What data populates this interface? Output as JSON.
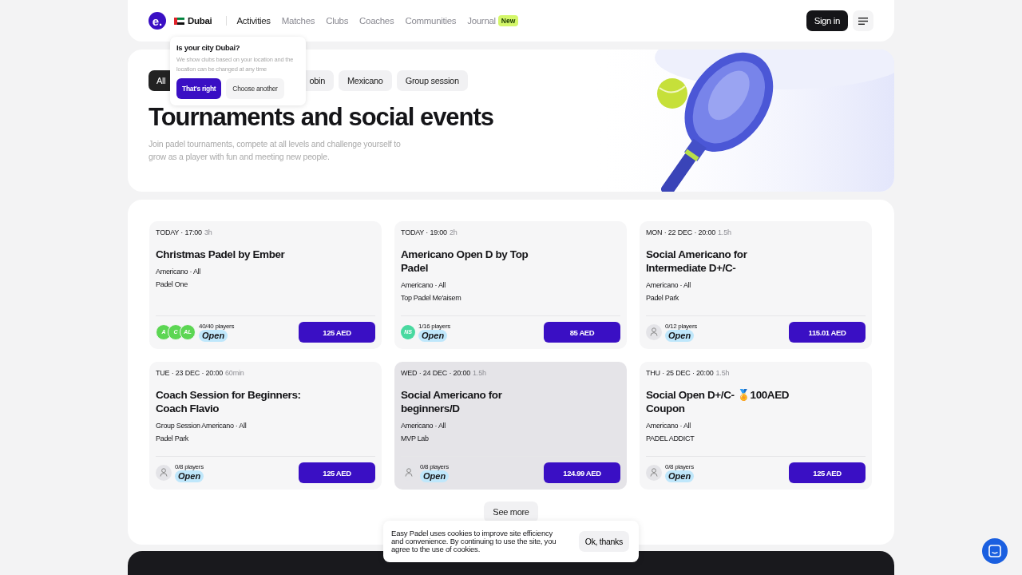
{
  "header": {
    "logo": "e.",
    "city": "Dubai",
    "nav": [
      {
        "label": "Activities",
        "selected": true
      },
      {
        "label": "Matches",
        "selected": false
      },
      {
        "label": "Clubs",
        "selected": false
      },
      {
        "label": "Coaches",
        "selected": false
      },
      {
        "label": "Communities",
        "selected": false
      },
      {
        "label": "Journal",
        "selected": false,
        "badge": "New"
      }
    ],
    "sign_in": "Sign in"
  },
  "city_popover": {
    "title": "Is your city Dubai?",
    "text": "We show clubs based on your location and the location can be changed at any time",
    "confirm": "That's right",
    "other": "Choose another"
  },
  "hero": {
    "filters": [
      {
        "label": "All",
        "selected": true
      },
      {
        "label": "obin",
        "selected": false
      },
      {
        "label": "Mexicano",
        "selected": false
      },
      {
        "label": "Group session",
        "selected": false
      }
    ],
    "title": "Tournaments and social events",
    "subtitle": "Join padel tournaments, compete at all levels and challenge yourself to grow as a player with fun and meeting new people."
  },
  "events": [
    {
      "when": "TODAY · 17:00",
      "duration": "3h",
      "title": "Christmas Padel by Ember",
      "format": "Americano · All",
      "club": "Padel One",
      "avatars": [
        "A",
        "C",
        "AL"
      ],
      "kind": "initials",
      "players": "40/40 players",
      "status": "Open",
      "price": "125 AED",
      "highlighted": false
    },
    {
      "when": "TODAY · 19:00",
      "duration": "2h",
      "title": "Americano Open D by Top Padel",
      "format": "Americano · All",
      "club": "Top Padel Me'aisem",
      "avatars": [
        "NS"
      ],
      "kind": "initials",
      "players": "1/16 players",
      "status": "Open",
      "price": "85 AED",
      "highlighted": false
    },
    {
      "when": "MON · 22 DEC · 20:00",
      "duration": "1.5h",
      "title": "Social Americano for Intermediate D+/C-",
      "format": "Americano · All",
      "club": "Padel Park",
      "kind": "empty",
      "players": "0/12 players",
      "status": "Open",
      "price": "115.01 AED",
      "highlighted": false
    },
    {
      "when": "TUE · 23 DEC · 20:00",
      "duration": "60min",
      "title": "Coach Session for Beginners: Coach Flavio",
      "format": "Group Session Americano · All",
      "club": "Padel Park",
      "kind": "empty",
      "players": "0/8 players",
      "status": "Open",
      "price": "125 AED",
      "highlighted": false
    },
    {
      "when": "WED · 24 DEC · 20:00",
      "duration": "1.5h",
      "title": "Social Americano for beginners/D",
      "format": "Americano · All",
      "club": "MVP Lab",
      "kind": "empty",
      "players": "0/8 players",
      "status": "Open",
      "price": "124.99 AED",
      "highlighted": true
    },
    {
      "when": "THU · 25 DEC · 20:00",
      "duration": "1.5h",
      "title": "Social Open D+/C- 🏅100AED Coupon",
      "format": "Americano · All",
      "club": "PADEL ADDICT",
      "kind": "empty",
      "players": "0/8 players",
      "status": "Open",
      "price": "125 AED",
      "highlighted": false
    }
  ],
  "see_more": "See more",
  "cookie_banner": {
    "text": "Easy Padel uses cookies to improve site efficiency and convenience. By continuing to use the site, you agree to the use of cookies.",
    "button": "Ok, thanks"
  }
}
